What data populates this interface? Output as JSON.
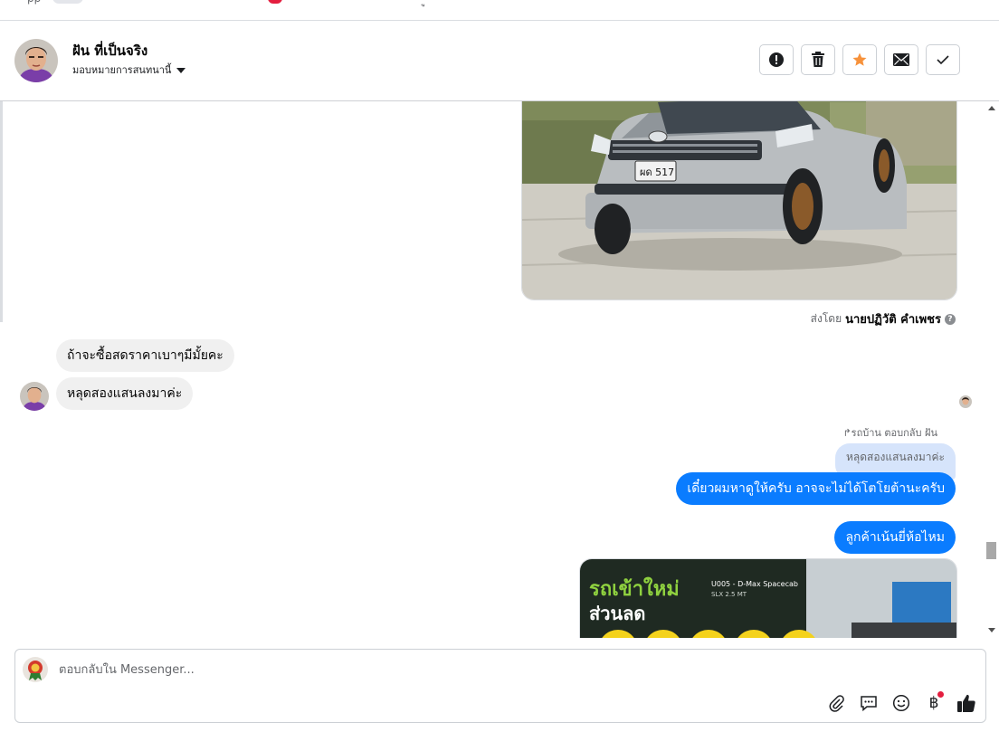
{
  "header": {
    "contact_name": "ฝัน ที่เป็นจริง",
    "assign_label": "มอบหมายการสนทนานี้",
    "actions": [
      {
        "icon": "alert-icon",
        "label": "spam"
      },
      {
        "icon": "trash-icon",
        "label": "delete"
      },
      {
        "icon": "star-icon",
        "label": "follow-up"
      },
      {
        "icon": "mail-icon",
        "label": "mark-unread"
      },
      {
        "icon": "check-icon",
        "label": "done"
      }
    ],
    "star_color": "#f7923b"
  },
  "thread": {
    "car_photo": {
      "plate": "ผด 517"
    },
    "sent_by_prefix": "ส่งโดย",
    "sent_by_name": "นายปฏิวัติ คำเพชร",
    "incoming": [
      "ถ้าจะซื้อสดราคาเบาๆมีมั้ยคะ",
      "หลุดสองแสนลงมาค่ะ"
    ],
    "reply_hint": "↱รถบ้าน ตอบกลับ ฝัน",
    "quoted_text": "หลุดสองแสนลงมาค่ะ",
    "outgoing": [
      "เดี๋ยวผมหาดูให้ครับ อาจจะไม่ได้โตโยต้านะครับ",
      "ลูกค้าเน้นยี่ห้อไหม"
    ],
    "promo_banner": {
      "headline": "รถเข้าใหม่",
      "subline": "ส่วนลด",
      "tag": "U005 - D-Max Spacecab",
      "spec": "SLX 2.5 MT"
    }
  },
  "composer": {
    "placeholder": "ตอบกลับใน Messenger..."
  },
  "colors": {
    "outgoing_bubble": "#0a7cff",
    "incoming_bubble": "#f0f0f0",
    "quoted_bubble": "#d6e4fb"
  }
}
